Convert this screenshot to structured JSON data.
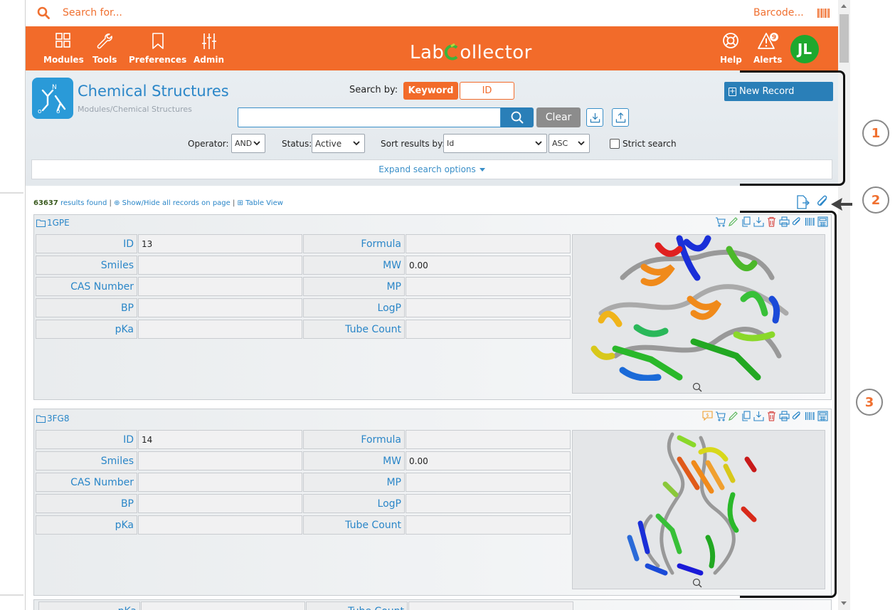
{
  "topbar": {
    "search_placeholder": "Search for...",
    "barcode_label": "Barcode..."
  },
  "nav": {
    "items": [
      {
        "label": "Modules",
        "icon": "grid-icon"
      },
      {
        "label": "Tools",
        "icon": "wrench-icon"
      },
      {
        "label": "Preferences",
        "icon": "bookmark-icon"
      },
      {
        "label": "Admin",
        "icon": "sliders-icon"
      }
    ],
    "logo_left": "Lab",
    "logo_right": "ollector",
    "help_label": "Help",
    "alerts_label": "Alerts",
    "alerts_count": "9",
    "avatar_initials": "JL"
  },
  "header": {
    "title": "Chemical Structures",
    "breadcrumb": "Modules/Chemical Structures",
    "search_by_label": "Search by:",
    "keyword_label": "Keyword",
    "id_label": "ID",
    "new_record_label": "New Record",
    "search_value": "",
    "clear_label": "Clear",
    "operator_label": "Operator:",
    "operator_value": "AND",
    "status_label": "Status:",
    "status_value": "Active",
    "sort_label": "Sort results by:",
    "sort_value": "Id",
    "order_value": "ASC",
    "strict_label": "Strict search",
    "expand_label": "Expand search options"
  },
  "results": {
    "count": "63637",
    "count_suffix": "results found",
    "toggle_label": "Show/Hide all records on page",
    "table_view_label": "Table View"
  },
  "records": [
    {
      "name": "1GPE",
      "fields": [
        {
          "label": "ID",
          "value": "13",
          "label2": "Formula",
          "value2": ""
        },
        {
          "label": "Smiles",
          "value": "",
          "label2": "MW",
          "value2": "0.00"
        },
        {
          "label": "CAS Number",
          "value": "",
          "label2": "MP",
          "value2": ""
        },
        {
          "label": "BP",
          "value": "",
          "label2": "LogP",
          "value2": ""
        },
        {
          "label": "pKa",
          "value": "",
          "label2": "Tube Count",
          "value2": ""
        }
      ]
    },
    {
      "name": "3FG8",
      "fields": [
        {
          "label": "ID",
          "value": "14",
          "label2": "Formula",
          "value2": ""
        },
        {
          "label": "Smiles",
          "value": "",
          "label2": "MW",
          "value2": "0.00"
        },
        {
          "label": "CAS Number",
          "value": "",
          "label2": "MP",
          "value2": ""
        },
        {
          "label": "BP",
          "value": "",
          "label2": "LogP",
          "value2": ""
        },
        {
          "label": "pKa",
          "value": "",
          "label2": "Tube Count",
          "value2": ""
        }
      ]
    }
  ],
  "partial_row": {
    "label": "pKa",
    "label2": "Tube Count"
  },
  "callouts": [
    "1",
    "2",
    "3"
  ],
  "colors": {
    "accent": "#f26b2a",
    "link": "#2a86c8",
    "primary_button": "#2a7fb8",
    "avatar": "#1ea82e"
  }
}
